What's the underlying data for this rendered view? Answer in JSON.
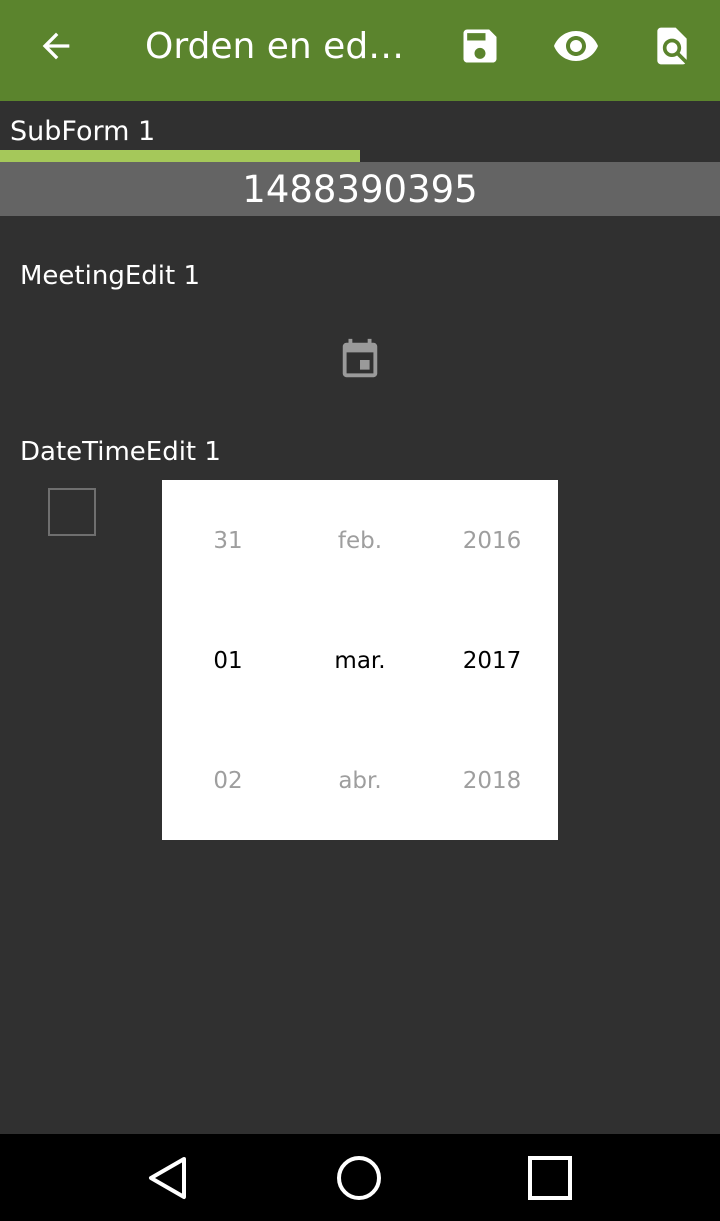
{
  "app_bar": {
    "title": "Orden en edi...",
    "back_icon": "arrow-back-icon",
    "save_icon": "save-icon",
    "preview_icon": "eye-icon",
    "search_icon": "find-in-page-icon",
    "background_color": "#5b842d"
  },
  "subform": {
    "label": "SubForm 1",
    "progress_fraction": 0.5,
    "progress_color": "#a5c85a"
  },
  "record": {
    "id": "1488390395"
  },
  "meeting_edit": {
    "label": "MeetingEdit 1",
    "calendar_icon": "calendar-icon"
  },
  "datetime_edit": {
    "label": "DateTimeEdit 1",
    "checked": false
  },
  "date_picker": {
    "day": {
      "prev": "31",
      "selected": "01",
      "next": "02"
    },
    "month": {
      "prev": "feb.",
      "selected": "mar.",
      "next": "abr."
    },
    "year": {
      "prev": "2016",
      "selected": "2017",
      "next": "2018"
    }
  },
  "system_nav": {
    "back_icon": "triangle-back-icon",
    "home_icon": "circle-home-icon",
    "recents_icon": "square-recents-icon"
  }
}
